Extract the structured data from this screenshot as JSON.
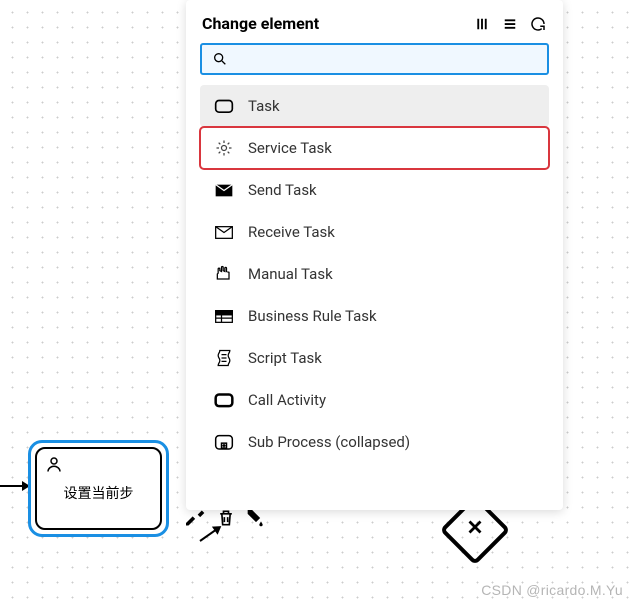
{
  "popup": {
    "title": "Change element",
    "search": {
      "placeholder": ""
    },
    "items": [
      {
        "label": "Task",
        "icon": "task-icon",
        "selected": true,
        "highlighted": false
      },
      {
        "label": "Service Task",
        "icon": "service-task-icon",
        "selected": false,
        "highlighted": true
      },
      {
        "label": "Send Task",
        "icon": "send-task-icon",
        "selected": false,
        "highlighted": false
      },
      {
        "label": "Receive Task",
        "icon": "receive-task-icon",
        "selected": false,
        "highlighted": false
      },
      {
        "label": "Manual Task",
        "icon": "manual-task-icon",
        "selected": false,
        "highlighted": false
      },
      {
        "label": "Business Rule Task",
        "icon": "business-rule-task-icon",
        "selected": false,
        "highlighted": false
      },
      {
        "label": "Script Task",
        "icon": "script-task-icon",
        "selected": false,
        "highlighted": false
      },
      {
        "label": "Call Activity",
        "icon": "call-activity-icon",
        "selected": false,
        "highlighted": false
      },
      {
        "label": "Sub Process (collapsed)",
        "icon": "sub-process-icon",
        "selected": false,
        "highlighted": false
      }
    ]
  },
  "canvas": {
    "task_label": "设置当前步"
  },
  "watermark": "CSDN @ricardo.M.Yu"
}
